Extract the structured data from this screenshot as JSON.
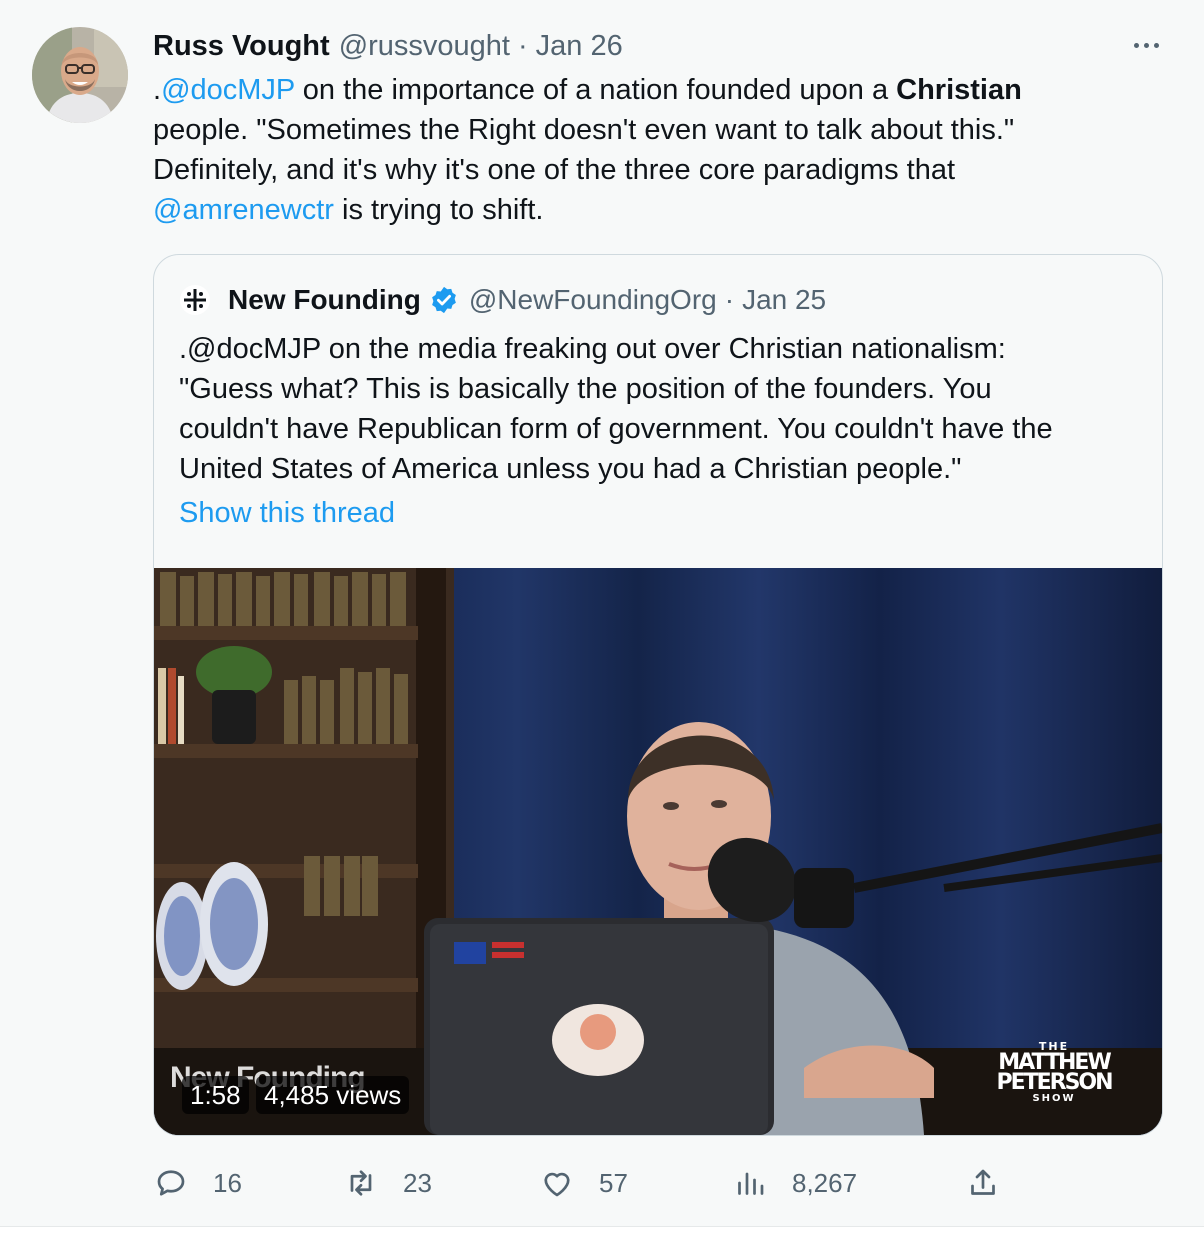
{
  "tweet": {
    "author_name": "Russ Vought",
    "author_handle": "@russvought",
    "separator": "·",
    "date": "Jan 26",
    "text": {
      "line1_prefix": ".",
      "line1_mention": "@docMJP",
      "line1_mid": " on the importance of a nation founded upon a ",
      "line1_bold": "Christian",
      "line2": "people. \"Sometimes the Right doesn't even want to talk about this.\"",
      "line3": "Definitely, and it's why it's one of the three core paradigms that",
      "line4_mention": "@amrenewctr",
      "line4_rest": " is trying to shift."
    },
    "more_icon": "more-horizontal-icon"
  },
  "quoted": {
    "author_name": "New Founding",
    "author_handle": "@NewFoundingOrg",
    "separator": "·",
    "date": "Jan 25",
    "text_lines": [
      ".@docMJP on the media freaking out over Christian nationalism:",
      "\"Guess what? This is basically the position of the founders. You",
      "couldn't have Republican form of government. You couldn't have the",
      "United States of America unless you had a Christian people.\""
    ],
    "show_thread": "Show this thread",
    "verified_color": "#1d9bf0",
    "video": {
      "watermark": "New Founding",
      "duration": "1:58",
      "views": "4,485 views",
      "show_logo": {
        "line1": "THE",
        "line2": "MATTHEW",
        "line3": "PETERSON",
        "line4": "SHOW"
      }
    }
  },
  "actions": {
    "reply": {
      "icon": "reply-icon",
      "count": "16"
    },
    "retweet": {
      "icon": "retweet-icon",
      "count": "23"
    },
    "like": {
      "icon": "heart-icon",
      "count": "57"
    },
    "views": {
      "icon": "analytics-icon",
      "count": "8,267"
    },
    "share": {
      "icon": "share-icon"
    }
  },
  "colors": {
    "link": "#1d9bf0",
    "muted": "#536471",
    "text": "#0f1419",
    "background": "#f7f9f9"
  }
}
